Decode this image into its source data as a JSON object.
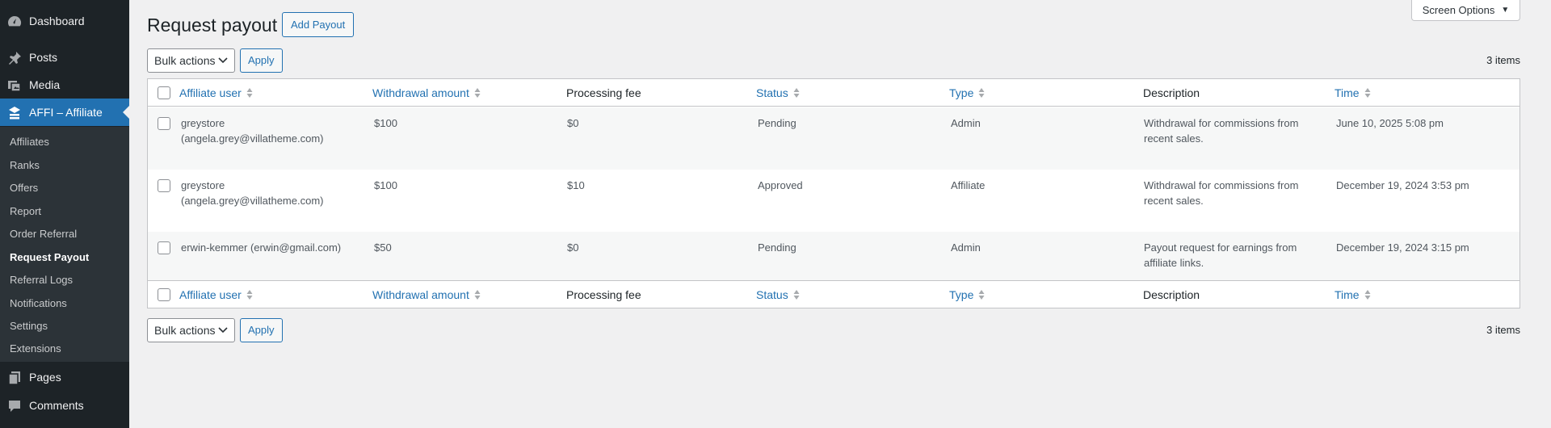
{
  "sidebar": {
    "menu": [
      {
        "label": "Dashboard",
        "icon": "dashboard-icon"
      },
      {
        "label": "Posts",
        "icon": "pin-icon"
      },
      {
        "label": "Media",
        "icon": "media-icon"
      },
      {
        "label": "AFFI – Affiliate",
        "icon": "affiliate-icon"
      },
      {
        "label": "Pages",
        "icon": "pages-icon"
      },
      {
        "label": "Comments",
        "icon": "comment-icon"
      }
    ],
    "submenu": [
      "Affiliates",
      "Ranks",
      "Offers",
      "Report",
      "Order Referral",
      "Request Payout",
      "Referral Logs",
      "Notifications",
      "Settings",
      "Extensions"
    ]
  },
  "header": {
    "title": "Request payout",
    "add_button": "Add Payout",
    "screen_options": "Screen Options"
  },
  "tablenav": {
    "bulk_label": "Bulk actions",
    "apply_label": "Apply",
    "count": "3 items"
  },
  "table": {
    "columns": [
      "Affiliate user",
      "Withdrawal amount",
      "Processing fee",
      "Status",
      "Type",
      "Description",
      "Time"
    ],
    "rows": [
      {
        "user": "greystore\n(angela.grey@villatheme.com)",
        "amount": "$100",
        "fee": "$0",
        "status": "Pending",
        "type": "Admin",
        "description": "Withdrawal for commissions from\nrecent sales.",
        "time": "June 10, 2025 5:08 pm"
      },
      {
        "user": "greystore\n(angela.grey@villatheme.com)",
        "amount": "$100",
        "fee": "$10",
        "status": "Approved",
        "type": "Affiliate",
        "description": "Withdrawal for commissions from\nrecent sales.",
        "time": "December 19, 2024 3:53 pm"
      },
      {
        "user": "erwin-kemmer (erwin@gmail.com)",
        "amount": "$50",
        "fee": "$0",
        "status": "Pending",
        "type": "Admin",
        "description": "Payout request for earnings from\naffiliate links.",
        "time": "December 19, 2024 3:15 pm"
      }
    ]
  },
  "colors": {
    "sidebar_bg": "#1d2327",
    "submenu_bg": "#2c3338",
    "accent": "#2271b1",
    "page_bg": "#f0f0f1"
  }
}
